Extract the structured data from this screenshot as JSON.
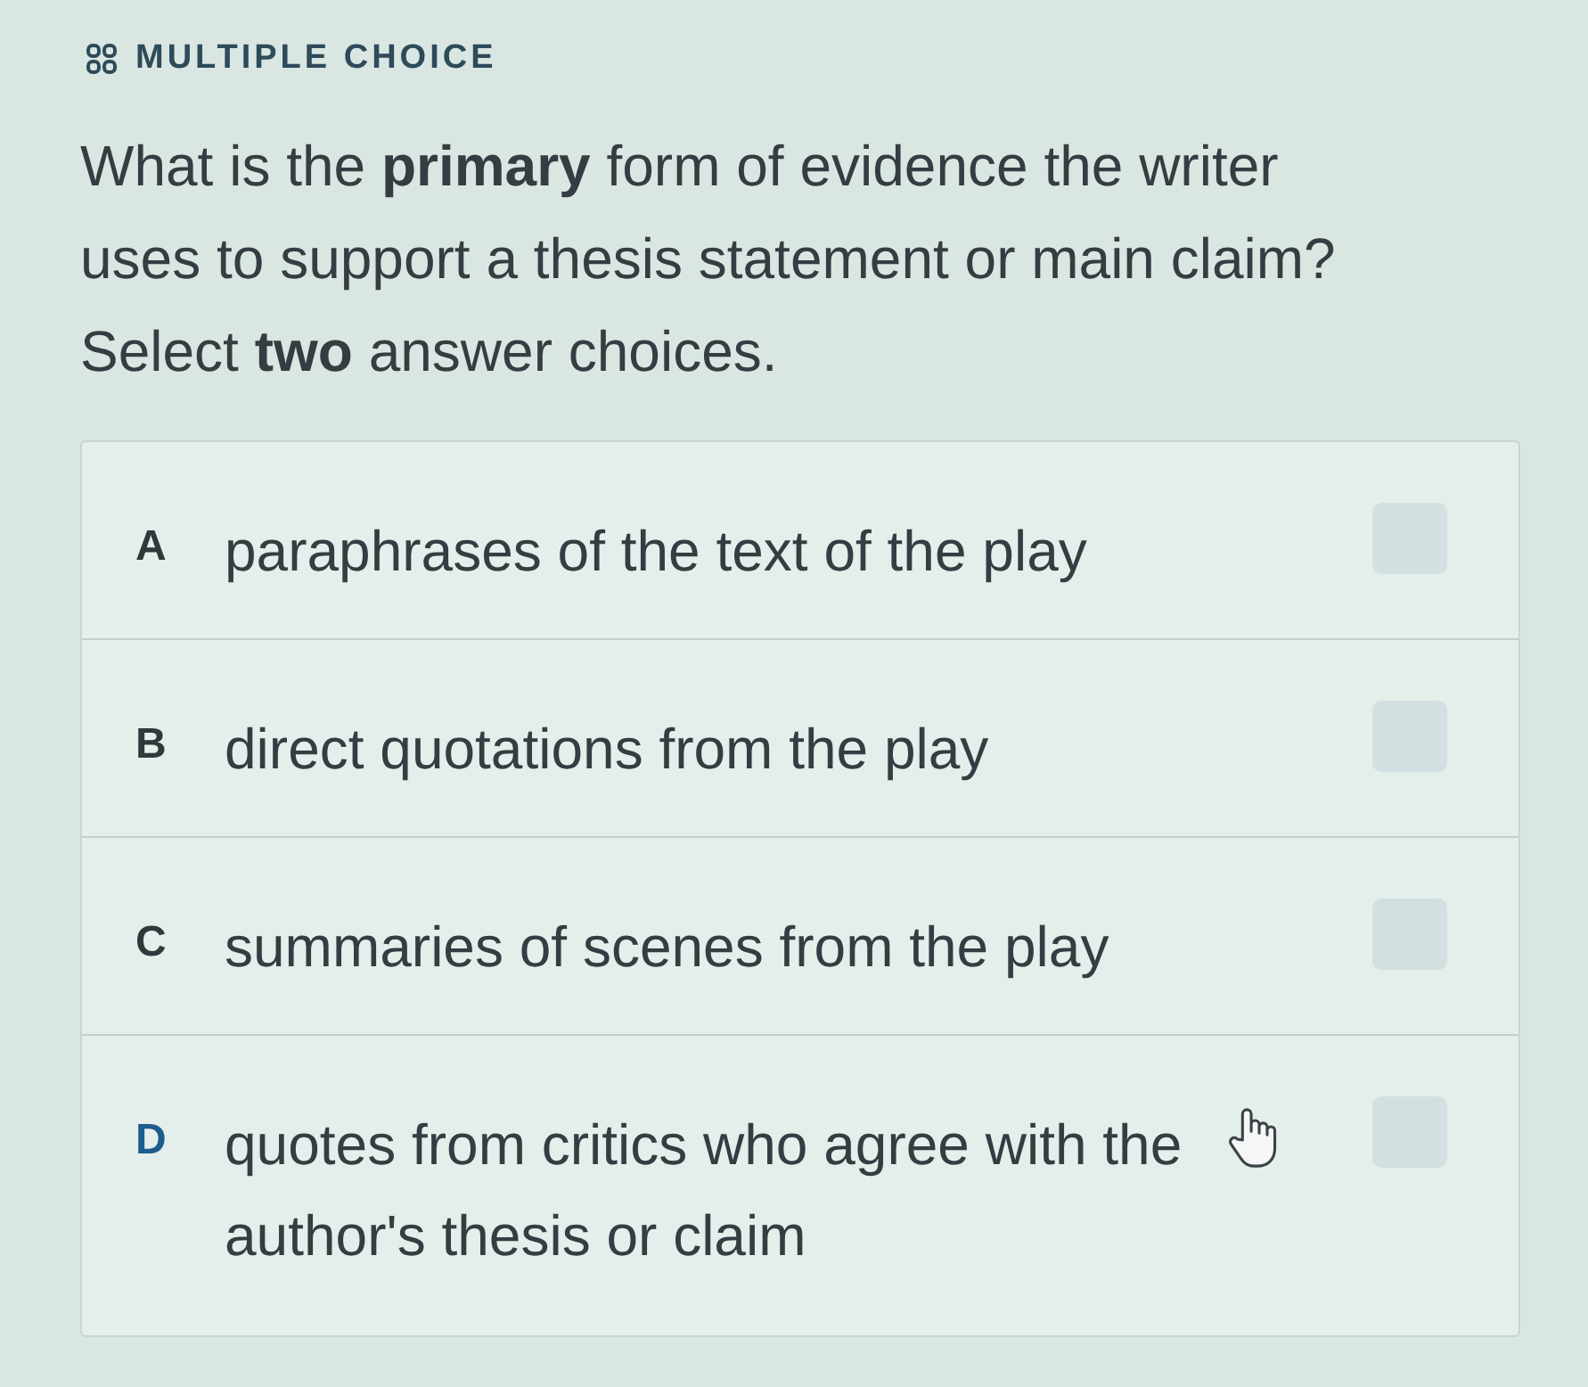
{
  "header": {
    "label": "MULTIPLE CHOICE"
  },
  "question": {
    "prompt": "What is the **primary** form of evidence the writer uses to support a thesis statement or main claim?",
    "instruction": "Select **two** answer choices."
  },
  "options": [
    {
      "letter": "A",
      "text": "paraphrases of the text of the play",
      "checked": false,
      "hovered": false
    },
    {
      "letter": "B",
      "text": "direct quotations from the play",
      "checked": false,
      "hovered": false
    },
    {
      "letter": "C",
      "text": "summaries of scenes from the play",
      "checked": false,
      "hovered": false
    },
    {
      "letter": "D",
      "text": "quotes from critics who agree with the author's thesis or claim",
      "checked": false,
      "hovered": true
    }
  ]
}
